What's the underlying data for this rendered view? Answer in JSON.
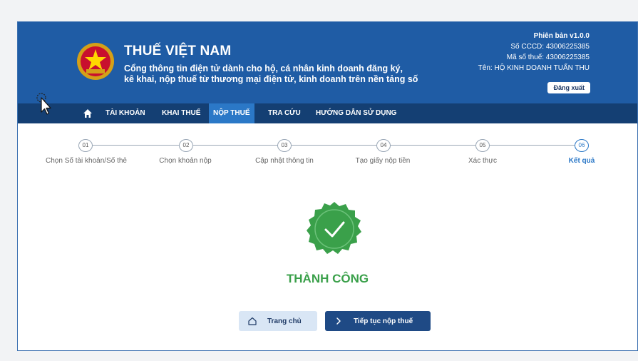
{
  "header": {
    "title": "THUẾ VIỆT NAM",
    "subtitle_line1": "Cổng thông tin điện tử dành cho hộ, cá nhân kinh doanh đăng ký,",
    "subtitle_line2": "kê khai, nộp thuế từ thương mại điện tử, kinh doanh trên nền tảng số",
    "emblem_icon": "national-emblem-icon"
  },
  "user": {
    "version": "Phiên bản v1.0.0",
    "cccd": "Số CCCD: 43006225385",
    "tax_code": "Mã số thuế: 43006225385",
    "name": "Tên: HỘ KINH DOANH TUẤN THU",
    "logout_label": "Đăng xuất"
  },
  "nav": {
    "home_icon": "home-icon",
    "items": [
      {
        "label": "TÀI KHOẢN"
      },
      {
        "label": "KHAI THUẾ"
      },
      {
        "label": "NỘP THUẾ"
      },
      {
        "label": "TRA CỨU"
      },
      {
        "label": "HƯỚNG DẪN SỬ DỤNG"
      }
    ],
    "active_index": 2
  },
  "stepper": {
    "current_step": 6,
    "steps": [
      {
        "num": "01",
        "label": "Chọn Số tài khoản/Số thẻ"
      },
      {
        "num": "02",
        "label": "Chọn khoản nộp"
      },
      {
        "num": "03",
        "label": "Cập nhật thông tin"
      },
      {
        "num": "04",
        "label": "Tạo giấy nộp tiền"
      },
      {
        "num": "05",
        "label": "Xác thực"
      },
      {
        "num": "06",
        "label": "Kết quả"
      }
    ]
  },
  "result": {
    "status_text": "THÀNH CÔNG",
    "icon": "check-badge-icon",
    "color": "#3aa04a"
  },
  "actions": {
    "home_label": "Trang chủ",
    "continue_label": "Tiếp tục nộp thuế"
  },
  "colors": {
    "header_bg": "#1f5ca5",
    "nav_bg": "#143f73",
    "active_tab": "#2b78c7",
    "success": "#3aa04a"
  }
}
